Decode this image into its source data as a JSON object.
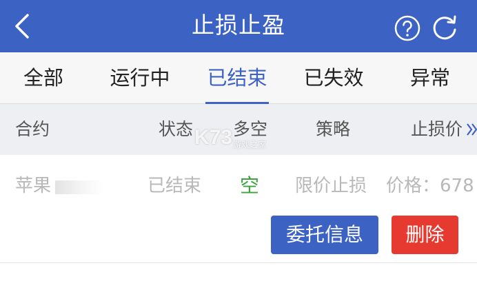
{
  "header": {
    "title": "止损止盈",
    "back_icon": "chevron-left-icon",
    "help_icon": "question-circle-icon",
    "refresh_icon": "refresh-icon",
    "background_color": "#3c63c4"
  },
  "tabs": [
    {
      "label": "全部",
      "active": false
    },
    {
      "label": "运行中",
      "active": false
    },
    {
      "label": "已结束",
      "active": true
    },
    {
      "label": "已失效",
      "active": false
    },
    {
      "label": "异常",
      "active": false
    }
  ],
  "columns": {
    "contract": "合约",
    "status": "状态",
    "direction": "多空",
    "strategy": "策略",
    "stop_price": "止损价",
    "more_icon": "double-chevron-right-icon"
  },
  "rows": [
    {
      "contract": "苹果",
      "status": "已结束",
      "direction": "空",
      "strategy": "限价止损",
      "price": "价格：678"
    }
  ],
  "actions": {
    "info_label": "委托信息",
    "delete_label": "删除"
  },
  "watermark": {
    "logo": "K73",
    "text": "游戏之家",
    "domain": ".com"
  },
  "colors": {
    "accent": "#3c63c4",
    "short_side": "#3aa43e",
    "danger": "#e63a30"
  }
}
